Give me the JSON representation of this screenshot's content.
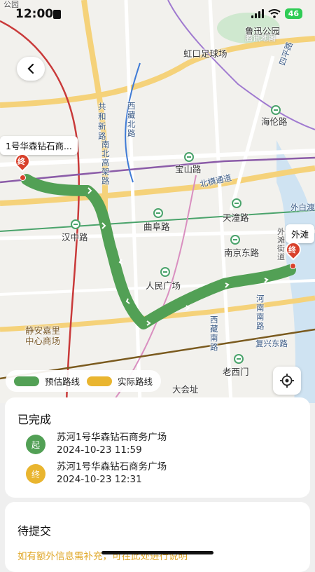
{
  "status": {
    "time": "12:00",
    "battery": "46"
  },
  "map": {
    "labels": {
      "luxun_park": "鲁迅公园",
      "tencent_map": "腾讯地图",
      "hongkou_stadium": "虹口足球场",
      "siping_road": "四平路",
      "hailun_road": "海伦路",
      "gonghexin_road": "共和新路",
      "nanbei_elevated": "南北高架路",
      "xizang_north_road": "西藏北路",
      "baoshan_road": "宝山路",
      "beiheng_road": "北横通道",
      "hanzhong_road": "汉中路",
      "qufu_road": "曲阜路",
      "tiantong_road": "天潼路",
      "waibaidu": "外白渡",
      "waitan_street": "外滩街道",
      "nanjing_east_road": "南京东路",
      "peoples_square": "人民广场",
      "henan_south_road": "河南南路",
      "xizang_south_road": "西藏南路",
      "jingan_kerry": "静安嘉里中心商场",
      "fuxing_east_road": "复兴东路",
      "laoximen": "老西门",
      "dashijie": "大会址",
      "park_top": "公园"
    },
    "start_label": "1号华森钻石商...",
    "end_label": "外滩",
    "end_pin_text": "终"
  },
  "legend": {
    "estimated": "预估路线",
    "actual": "实际路线",
    "estimated_color": "#52a055",
    "actual_color": "#e9b52f"
  },
  "completed": {
    "title": "已完成",
    "start": {
      "badge": "起",
      "place": "苏河1号华森钻石商务广场",
      "time": "2024-10-23 11:59",
      "color": "#52a055"
    },
    "end": {
      "badge": "终",
      "place": "苏河1号华森钻石商务广场",
      "time": "2024-10-23 12:31",
      "color": "#e9b52f"
    }
  },
  "pending": {
    "title": "待提交",
    "hint": "如有额外信息需补充，可在此处进行说明"
  }
}
